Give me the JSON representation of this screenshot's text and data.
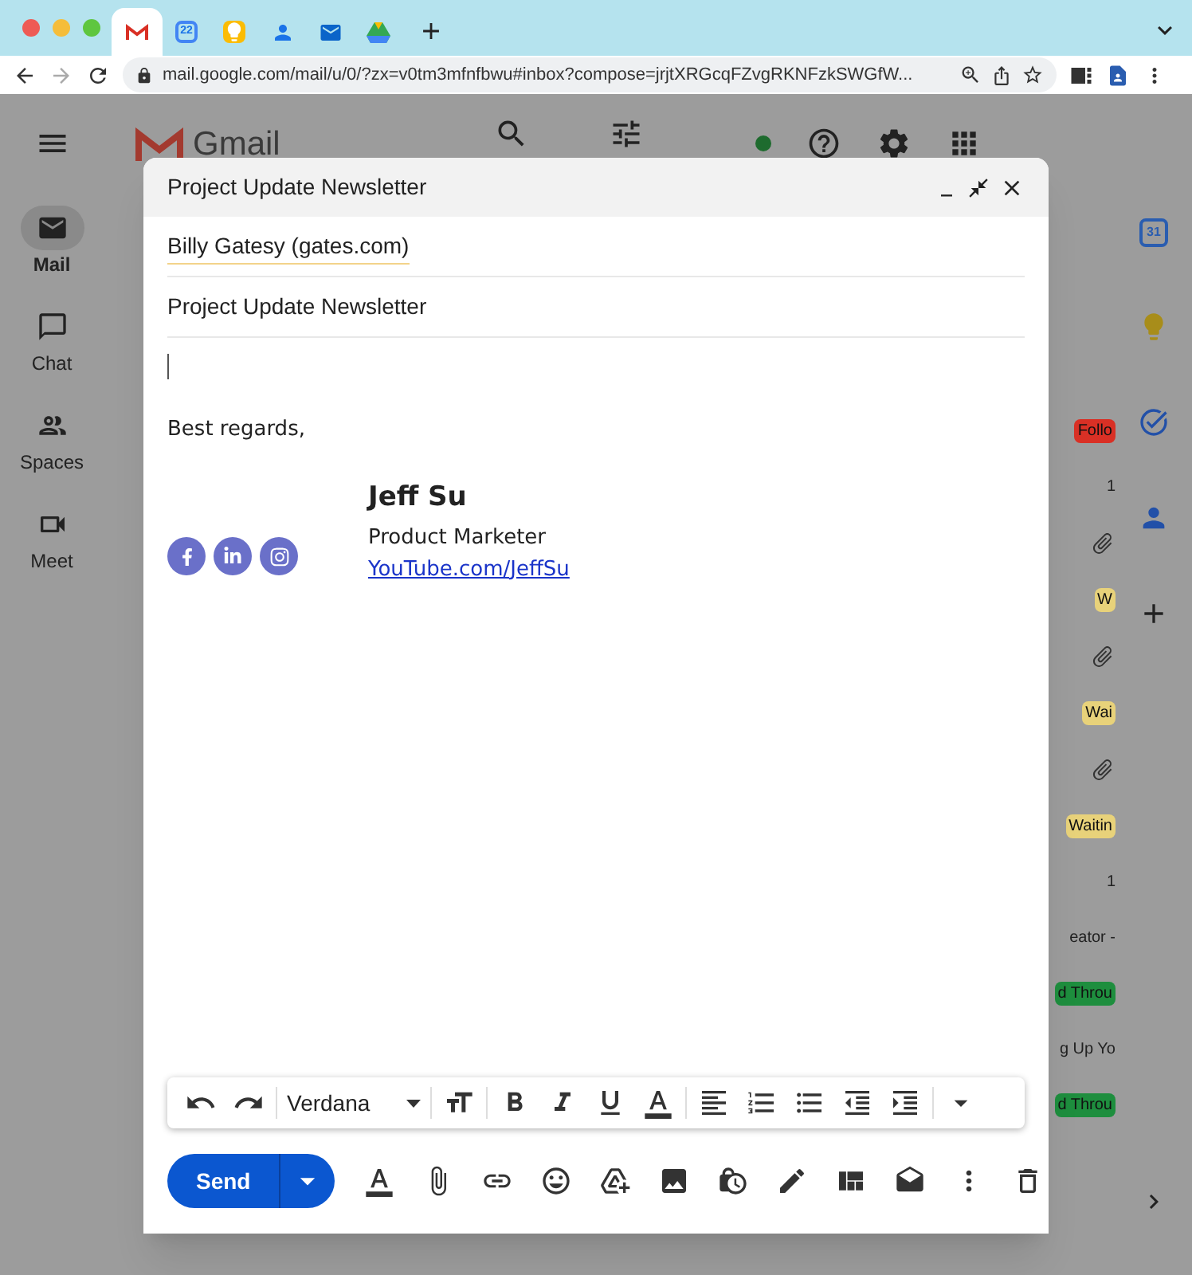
{
  "browser": {
    "tabs": [
      {
        "kind": "gmail",
        "selected": true
      },
      {
        "kind": "calendar",
        "text": "22",
        "selected": false
      },
      {
        "kind": "keep",
        "selected": false
      },
      {
        "kind": "contacts",
        "selected": false
      },
      {
        "kind": "outlook",
        "selected": false
      },
      {
        "kind": "drive",
        "selected": false
      }
    ],
    "address": "mail.google.com/mail/u/0/?zx=v0tm3mfnfbwu#inbox?compose=jrjtXRGcqFZvgRKNFzkSWGfW..."
  },
  "gmail": {
    "logo": "Gmail",
    "rail": [
      {
        "label": "Mail",
        "kind": "mail",
        "selected": true
      },
      {
        "label": "Chat",
        "kind": "chat",
        "selected": false
      },
      {
        "label": "Spaces",
        "kind": "spaces",
        "selected": false
      },
      {
        "label": "Meet",
        "kind": "meet",
        "selected": false
      }
    ],
    "inbox_fragments": [
      {
        "kind": "tag",
        "text": "Follo",
        "color": "#d93025"
      },
      {
        "kind": "text",
        "text": "1"
      },
      {
        "kind": "clip"
      },
      {
        "kind": "tag",
        "text": "W",
        "color": "#e8d27a"
      },
      {
        "kind": "clip"
      },
      {
        "kind": "tag",
        "text": "Wai",
        "color": "#e8d27a"
      },
      {
        "kind": "clip"
      },
      {
        "kind": "tag",
        "text": "Waitin",
        "color": "#e8d27a"
      },
      {
        "kind": "text",
        "text": "1"
      },
      {
        "kind": "text",
        "text": "eator -"
      },
      {
        "kind": "tag",
        "text": "d Throu",
        "color": "#1e8e3e"
      },
      {
        "kind": "text",
        "text": "g Up Yo"
      },
      {
        "kind": "tag",
        "text": "d Throu",
        "color": "#1e8e3e"
      }
    ],
    "side_apps": [
      {
        "kind": "calendar",
        "text": "31"
      },
      {
        "kind": "keep"
      },
      {
        "kind": "tasks"
      },
      {
        "kind": "contacts"
      }
    ]
  },
  "compose": {
    "title": "Project Update Newsletter",
    "to": "Billy Gatesy (gates.com)",
    "subject": "Project Update Newsletter",
    "greeting": "Best regards,",
    "signature": {
      "name": "Jeff Su",
      "role": "Product Marketer",
      "link": "YouTube.com/JeffSu"
    },
    "font": "Verdana",
    "send": "Send"
  }
}
